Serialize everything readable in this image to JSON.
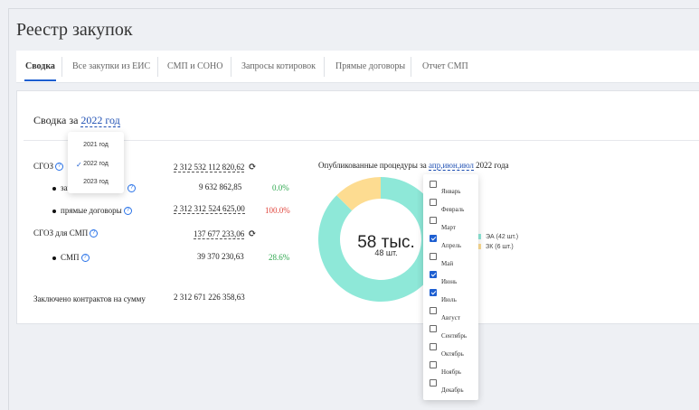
{
  "page": {
    "title": "Реестр закупок"
  },
  "tabs": [
    {
      "label": "Сводка",
      "active": true
    },
    {
      "label": "Все закупки из ЕИС"
    },
    {
      "label": "СМП и СОНО"
    },
    {
      "label": "Запросы котировок"
    },
    {
      "label": "Прямые договоры"
    },
    {
      "label": "Отчет СМП"
    }
  ],
  "summary": {
    "title_prefix": "Сводка за",
    "year_link": "2022 год"
  },
  "year_dropdown": {
    "options": [
      "2021 год",
      "2022 год",
      "2023 год"
    ],
    "selected": "2022 год",
    "check": "✓"
  },
  "metrics": {
    "sgoz": {
      "label": "СГОЗ",
      "value": "2 312 532 112 820,62",
      "refresh": "⟳"
    },
    "zap": {
      "label": "зап",
      "value": "9 632 862,85",
      "pct": "0.0%"
    },
    "direct": {
      "label": "прямые договоры",
      "value": "2 312 312 524 625,00",
      "pct": "100.0%"
    },
    "sgoz_smp": {
      "label": "СГОЗ для СМП",
      "value": "137 677 233,06",
      "refresh": "⟳"
    },
    "smp": {
      "label": "СМП",
      "value": "39 370 230,63",
      "pct": "28.6%"
    },
    "contracts": {
      "label": "Заключено контрактов на сумму",
      "value": "2 312 671 226 358,63"
    },
    "help_glyph": "?"
  },
  "chart_title": {
    "prefix": "Опубликованные процедуры за",
    "months_link": "апр,июн,июл",
    "suffix": "2022 года"
  },
  "chart_data": {
    "type": "pie",
    "donut": true,
    "center_value": "58 тыс.",
    "center_sub": "48 шт.",
    "series": [
      {
        "name": "ЭА (42 шт.)",
        "value": 42,
        "color": "#8ee8d8"
      },
      {
        "name": "ЗК (6 шт.)",
        "value": 6,
        "color": "#fddc91"
      }
    ]
  },
  "month_dropdown": {
    "months": [
      {
        "label": "Январь",
        "checked": false
      },
      {
        "label": "Февраль",
        "checked": false
      },
      {
        "label": "Март",
        "checked": false
      },
      {
        "label": "Апрель",
        "checked": true
      },
      {
        "label": "Май",
        "checked": false
      },
      {
        "label": "Июнь",
        "checked": true
      },
      {
        "label": "Июль",
        "checked": true
      },
      {
        "label": "Август",
        "checked": false
      },
      {
        "label": "Сентябрь",
        "checked": false
      },
      {
        "label": "Октябрь",
        "checked": false
      },
      {
        "label": "Ноябрь",
        "checked": false
      },
      {
        "label": "Декабрь",
        "checked": false
      }
    ]
  },
  "colors": {
    "accent": "#1e5fd1",
    "link": "#1e4fb3",
    "green": "#2fa84f",
    "red": "#e0453c"
  }
}
